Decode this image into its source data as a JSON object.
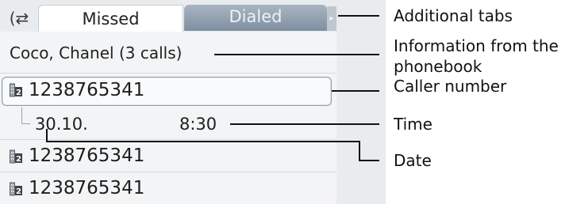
{
  "tabs": {
    "back_icon": "(⇄",
    "missed_label": "Missed",
    "dialed_label": "Dialed",
    "more_icon": "▸"
  },
  "info": {
    "text": "Coco, Chanel (3 calls)"
  },
  "calls": [
    {
      "number": "1238765341",
      "icon": "phonebook-entry-icon"
    },
    {
      "number": "1238765341",
      "icon": "phonebook-entry-icon"
    },
    {
      "number": "1238765341",
      "icon": "phonebook-entry-icon"
    }
  ],
  "detail": {
    "date": "30.10.",
    "time": "8:30"
  },
  "annotations": {
    "additional_tabs": "Additional tabs",
    "phonebook_info_line1": "Information from the",
    "phonebook_info_line2": "phonebook",
    "caller_number": "Caller number",
    "time": "Time",
    "date": "Date"
  },
  "colors": {
    "screen_bg": "#e9ecef",
    "selected_tab_bg": "#ffffff",
    "inactive_tab_bg": "#8a9aab",
    "selection_border": "#8fa0b1"
  }
}
